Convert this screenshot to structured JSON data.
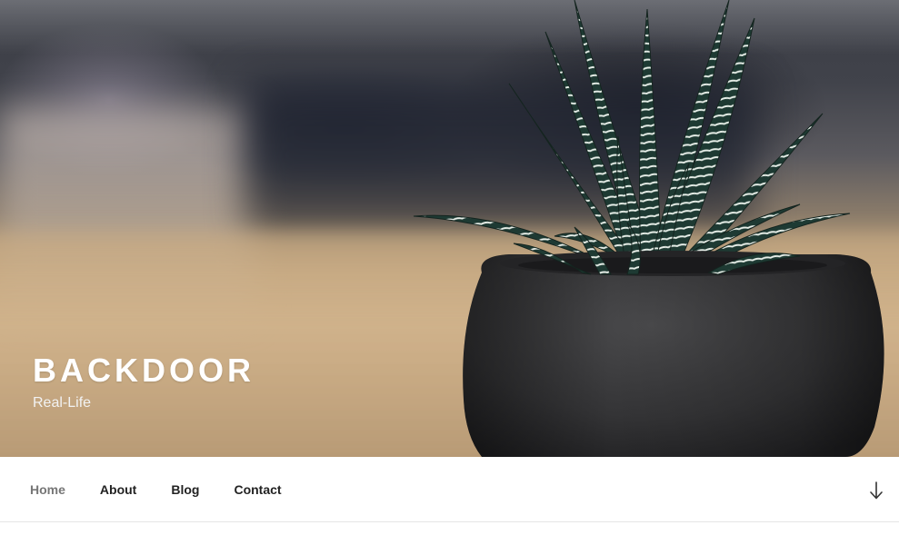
{
  "site": {
    "title": "BACKDOOR",
    "description": "Real-Life"
  },
  "hero": {
    "image_subject": "zebra-haworthia-succulent-in-black-pot"
  },
  "nav": {
    "items": [
      {
        "label": "Home",
        "current": true
      },
      {
        "label": "About",
        "current": false
      },
      {
        "label": "Blog",
        "current": false
      },
      {
        "label": "Contact",
        "current": false
      }
    ],
    "scroll_icon": "arrow-down-icon"
  },
  "colors": {
    "title_text": "#ffffff",
    "nav_text": "#222222",
    "nav_current": "#767676",
    "nav_border": "#e5e5e5"
  }
}
